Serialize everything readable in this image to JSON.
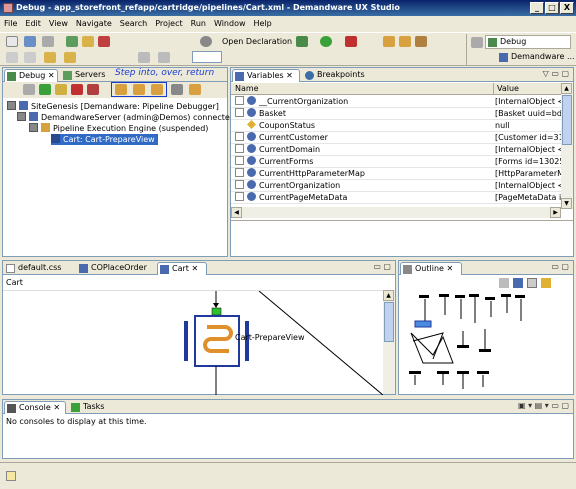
{
  "window": {
    "title": "Debug - app_storefront_refapp/cartridge/pipelines/Cart.xml - Demandware UX Studio",
    "min": "_",
    "max": "□",
    "close": "X"
  },
  "menu": [
    "File",
    "Edit",
    "View",
    "Navigate",
    "Search",
    "Project",
    "Run",
    "Window",
    "Help"
  ],
  "toolbar": {
    "open_declaration": "Open Declaration",
    "perspective_debug": "Debug",
    "perspective_demandware": "Demandware ..."
  },
  "debug_view": {
    "tabs": [
      "Debug",
      "Servers"
    ],
    "annotation": "Step into, over, return",
    "tree": [
      "SiteGenesis [Demandware: Pipeline Debugger]",
      "DemandwareServer (admin@Demos) connected.",
      "Pipeline Execution Engine (suspended)",
      "Cart: Cart-PrepareView"
    ]
  },
  "variables_view": {
    "tabs": [
      "Variables",
      "Breakpoints"
    ],
    "columns": [
      "Name",
      "Value"
    ],
    "rows": [
      {
        "name": "__CurrentOrganization",
        "value": "[InternalObject <co"
      },
      {
        "name": "Basket",
        "value": "[Basket uuid=bdngo"
      },
      {
        "name": "CouponStatus",
        "value": "null"
      },
      {
        "name": "CurrentCustomer",
        "value": "[Customer id=3188:"
      },
      {
        "name": "CurrentDomain",
        "value": "[InternalObject <co"
      },
      {
        "name": "CurrentForms",
        "value": "[Forms id=1302592("
      },
      {
        "name": "CurrentHttpParameterMap",
        "value": "[HttpParameterMap"
      },
      {
        "name": "CurrentOrganization",
        "value": "[InternalObject <co"
      },
      {
        "name": "CurrentPageMetaData",
        "value": "[PageMetaData id=<"
      }
    ]
  },
  "editor": {
    "tabs": [
      "default.css",
      "COPlaceOrder",
      "Cart"
    ],
    "breadcrumb": "Cart",
    "node_label": "Cart-PrepareView"
  },
  "outline": {
    "tab": "Outline"
  },
  "console": {
    "tabs": [
      "Console",
      "Tasks"
    ],
    "message": "No consoles to display at this time."
  },
  "status": {
    "icon": "status-icon"
  },
  "colors": {
    "title_start": "#0a246a",
    "title_end": "#3a6ea5",
    "chrome": "#ece9d8",
    "border": "#7f9db9",
    "annotation": "#1a3ccc",
    "node": "#1f3a9c",
    "node_fill": "#f4b860"
  }
}
